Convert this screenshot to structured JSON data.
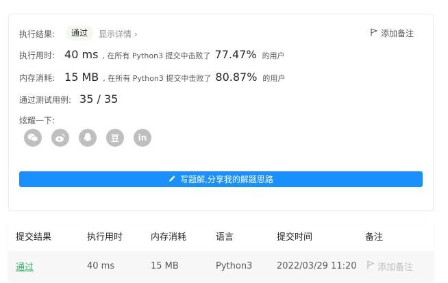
{
  "result": {
    "result_label": "执行结果:",
    "status": "通过",
    "detail_link": "显示详情 ›",
    "add_note": "添加备注"
  },
  "runtime": {
    "label": "执行用时:",
    "value": "40 ms",
    "text": ", 在所有 Python3 提交中击败了",
    "percent": "77.47%",
    "tail": "的用户"
  },
  "memory": {
    "label": "内存消耗:",
    "value": "15 MB",
    "text": ", 在所有 Python3 提交中击败了",
    "percent": "80.87%",
    "tail": "的用户"
  },
  "tests": {
    "label": "通过测试用例:",
    "value": "35 / 35"
  },
  "share": {
    "label": "炫耀一下:",
    "icons": [
      "wechat-icon",
      "weibo-icon",
      "qq-icon",
      "douban-icon",
      "linkedin-icon"
    ],
    "douban_glyph": "豆",
    "linkedin_glyph": "in"
  },
  "write_button": "写题解,分享我的解题思路",
  "table": {
    "headers": [
      "提交结果",
      "执行用时",
      "内存消耗",
      "语言",
      "提交时间",
      "备注"
    ],
    "row": {
      "result": "通过",
      "runtime": "40 ms",
      "memory": "15 MB",
      "language": "Python3",
      "time": "2022/03/29 11:20",
      "note": "添加备注"
    }
  },
  "colors": {
    "accent": "#1a90ff",
    "success": "#2db55d",
    "icon_gray": "#bfbfbf"
  }
}
